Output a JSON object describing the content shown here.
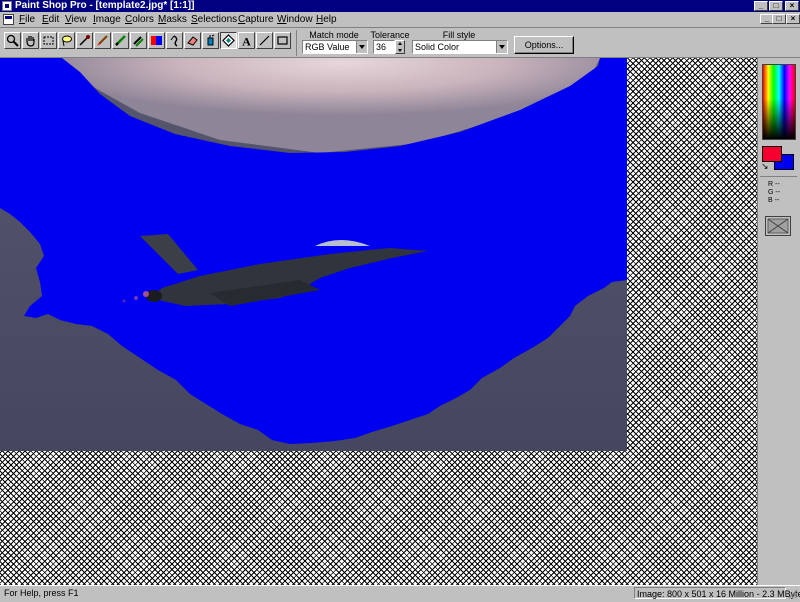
{
  "window": {
    "title": "Paint Shop Pro - [template2.jpg* [1:1]]",
    "controls": {
      "minimize": "_",
      "maximize": "□",
      "close": "×"
    }
  },
  "menubar": {
    "items": [
      "File",
      "Edit",
      "View",
      "Image",
      "Colors",
      "Masks",
      "Selections",
      "Capture",
      "Window",
      "Help"
    ],
    "doc_controls": {
      "minimize": "_",
      "restore": "□",
      "close": "×"
    }
  },
  "toolbar": {
    "tools": [
      {
        "name": "zoom-icon"
      },
      {
        "name": "hand-icon"
      },
      {
        "name": "rectangle-select-icon"
      },
      {
        "name": "lasso-icon"
      },
      {
        "name": "eyedropper-icon"
      },
      {
        "name": "paintbrush-icon"
      },
      {
        "name": "pencil-icon"
      },
      {
        "name": "clone-brush-icon"
      },
      {
        "name": "color-replacer-icon"
      },
      {
        "name": "retouch-icon"
      },
      {
        "name": "eraser-icon"
      },
      {
        "name": "airbrush-icon"
      },
      {
        "name": "flood-fill-icon",
        "active": true
      },
      {
        "name": "text-icon"
      },
      {
        "name": "line-icon"
      },
      {
        "name": "shape-icon"
      }
    ],
    "options": {
      "match_mode_label": "Match mode",
      "match_mode_value": "RGB Value",
      "tolerance_label": "Tolerance",
      "tolerance_value": "36",
      "fill_style_label": "Fill style",
      "fill_style_value": "Solid Color",
      "options_button": "Options..."
    }
  },
  "palette": {
    "foreground_color": "#f5002e",
    "background_color": "#0000f0",
    "swap_glyph": "↘",
    "rows": [
      {
        "key": "R",
        "value": "--"
      },
      {
        "key": "G",
        "value": "--"
      },
      {
        "key": "B",
        "value": "--"
      }
    ]
  },
  "statusbar": {
    "help_text": "For Help, press F1",
    "image_info": "Image:  800 x 501 x 16 Million - 2.3 MBytes"
  },
  "colors": {
    "title_bar": "#000080",
    "fill_blue": "#0000f0",
    "sky_gray": "#4d4f6a",
    "sky_pink": "#c9b3bc"
  }
}
